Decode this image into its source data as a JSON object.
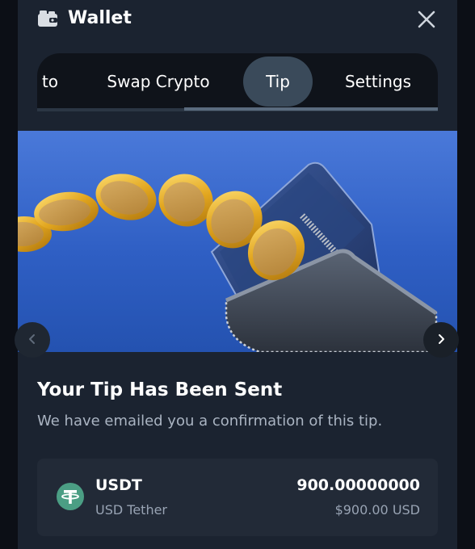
{
  "header": {
    "title": "Wallet",
    "icons": {
      "wallet": "wallet-icon",
      "close": "close-icon"
    }
  },
  "tabs": [
    {
      "label": "to",
      "active": false
    },
    {
      "label": "Swap Crypto",
      "active": false
    },
    {
      "label": "Tip",
      "active": true
    },
    {
      "label": "Settings",
      "active": false
    }
  ],
  "hero": {
    "image": "coins-flowing-from-wallet-illustration",
    "prev_icon": "chevron-left-icon",
    "next_icon": "chevron-right-icon"
  },
  "confirmation": {
    "headline": "Your Tip Has Been Sent",
    "message": "We have emailed you a confirmation of this tip."
  },
  "transaction": {
    "symbol": "USDT",
    "name": "USD Tether",
    "amount": "900.00000000",
    "fiat_value": "$900.00 USD",
    "icon": "tether-icon"
  },
  "colors": {
    "background": "#1b2330",
    "active_tab": "#3a4a5a",
    "card": "#222a37",
    "tether": "#4b9e84",
    "coin_gold": "#e0a526",
    "sky_blue": "#2a55b8"
  }
}
